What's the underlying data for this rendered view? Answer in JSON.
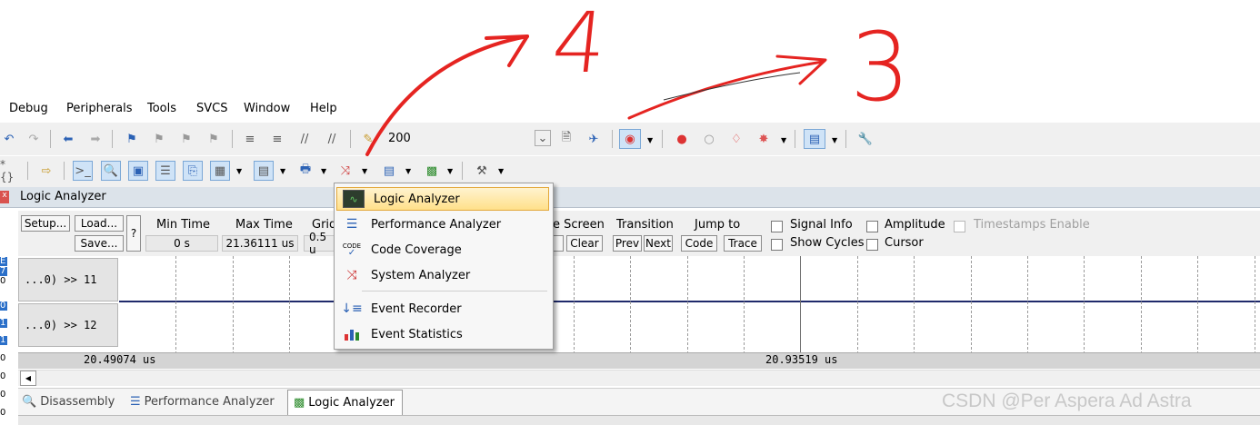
{
  "menubar": [
    "Debug",
    "Peripherals",
    "Tools",
    "SVCS",
    "Window",
    "Help"
  ],
  "toolbar1": {
    "value_field": "200"
  },
  "panel": {
    "title": "Logic Analyzer",
    "setup_label": "Setup...",
    "load_label": "Load...",
    "save_label": "Save...",
    "help_label": "?",
    "min_time_label": "Min Time",
    "min_time_value": "0 s",
    "max_time_label": "Max Time",
    "max_time_value": "21.36111 us",
    "grid_label": "Grid",
    "grid_value": "0.5 u",
    "screen_label": "e Screen",
    "clear_label": "Clear",
    "transition_label": "Transition",
    "prev_label": "Prev",
    "next_label": "Next",
    "jump_label": "Jump to",
    "code_label": "Code",
    "trace_label": "Trace",
    "signal_info": "Signal Info",
    "show_cycles": "Show Cycles",
    "amplitude": "Amplitude",
    "cursor": "Cursor",
    "timestamps": "Timestamps Enable",
    "signals": [
      "...0) >> 11",
      "...0) >> 12"
    ],
    "time_left": "20.49074 us",
    "time_right": "20.93519 us"
  },
  "dropdown": {
    "items": [
      {
        "label": "Logic Analyzer",
        "icon": "logic-analyzer-icon"
      },
      {
        "label": "Performance Analyzer",
        "icon": "performance-analyzer-icon"
      },
      {
        "label": "Code Coverage",
        "icon": "code-coverage-icon"
      },
      {
        "label": "System Analyzer",
        "icon": "system-analyzer-icon"
      },
      {
        "label": "Event Recorder",
        "icon": "event-recorder-icon"
      },
      {
        "label": "Event Statistics",
        "icon": "event-statistics-icon"
      }
    ]
  },
  "tabs": [
    "Disassembly",
    "Performance Analyzer",
    "Logic Analyzer"
  ],
  "watermark": "CSDN @Per  Aspera Ad Astra",
  "annotations": [
    "4",
    "3"
  ],
  "left_edge_chars": [
    "E",
    "7",
    "0",
    "0",
    "1",
    "1",
    "0",
    "0",
    "0",
    "0"
  ],
  "colors": {
    "accent": "#cfe3f7",
    "highlight": "#ffe08a",
    "annotation_red": "#e52421",
    "trace": "#1f2a6b"
  }
}
